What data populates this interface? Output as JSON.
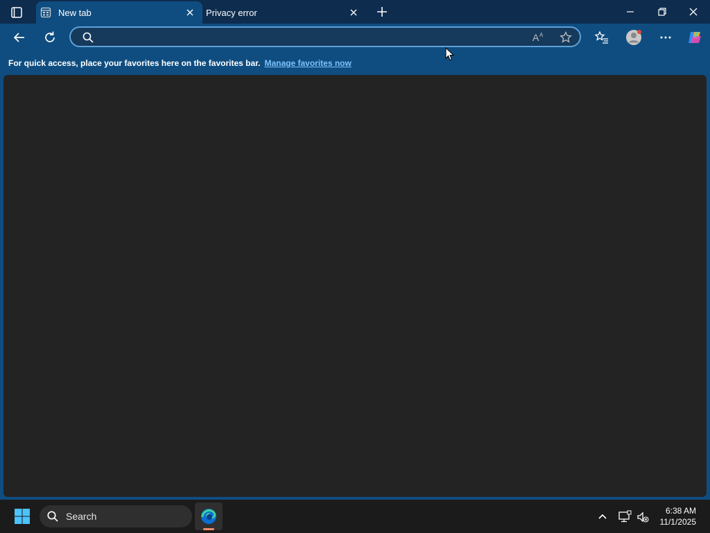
{
  "browser": {
    "tabs": [
      {
        "label": "New tab",
        "active": true
      },
      {
        "label": "Privacy error",
        "active": false
      }
    ],
    "address_bar": {
      "value": "",
      "placeholder": ""
    },
    "favorites_bar": {
      "message": "For quick access, place your favorites here on the favorites bar.",
      "link": "Manage favorites now"
    },
    "icons": {
      "tab_actions": "tab-actions-icon",
      "back": "back-arrow-icon",
      "refresh": "refresh-icon",
      "read_aloud": "read-aloud-icon",
      "favorite": "star-icon",
      "favorites": "favorites-icon",
      "profile": "profile-icon",
      "more": "more-icon",
      "copilot": "copilot-icon"
    },
    "colors": {
      "tab_strip": "#0e2c4e",
      "toolbar": "#0f4d80",
      "accent_link": "#7cc3ff",
      "content_bg": "#232323"
    }
  },
  "taskbar": {
    "search_label": "Search",
    "clock": {
      "time": "6:38 AM",
      "date": "11/1/2025"
    }
  }
}
